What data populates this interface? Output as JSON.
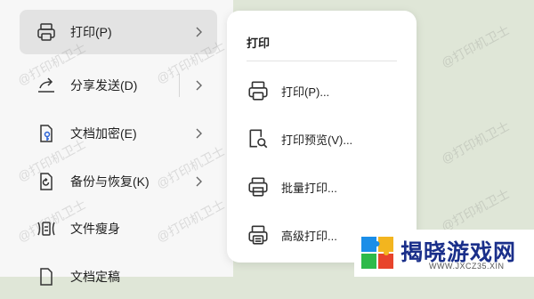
{
  "menu": {
    "items": [
      {
        "label": "打印(P)",
        "icon": "printer-icon",
        "chevron": true,
        "active": true
      },
      {
        "label": "分享发送(D)",
        "icon": "share-icon",
        "chevron": true,
        "separator": true
      },
      {
        "label": "文档加密(E)",
        "icon": "document-lock-icon",
        "chevron": true
      },
      {
        "label": "备份与恢复(K)",
        "icon": "backup-restore-icon",
        "chevron": true
      },
      {
        "label": "文件瘦身",
        "icon": "file-slim-icon",
        "chevron": false
      },
      {
        "label": "文档定稿",
        "icon": "document-finalize-icon",
        "chevron": false
      }
    ]
  },
  "submenu": {
    "title": "打印",
    "items": [
      {
        "label": "打印(P)...",
        "icon": "printer-icon"
      },
      {
        "label": "打印预览(V)...",
        "icon": "print-preview-icon"
      },
      {
        "label": "批量打印...",
        "icon": "batch-print-icon"
      },
      {
        "label": "高级打印...",
        "icon": "advanced-print-icon"
      }
    ]
  },
  "watermark": "@打印机卫士",
  "logo": {
    "brand": "揭晓游戏网",
    "domain": "WWW.JXCZ35.XIN"
  },
  "colors": {
    "menu_bg": "#f7f7f7",
    "active_bg": "#e3e3e3",
    "page_bg": "#dfe6d7",
    "brand": "#1a2f8a"
  }
}
